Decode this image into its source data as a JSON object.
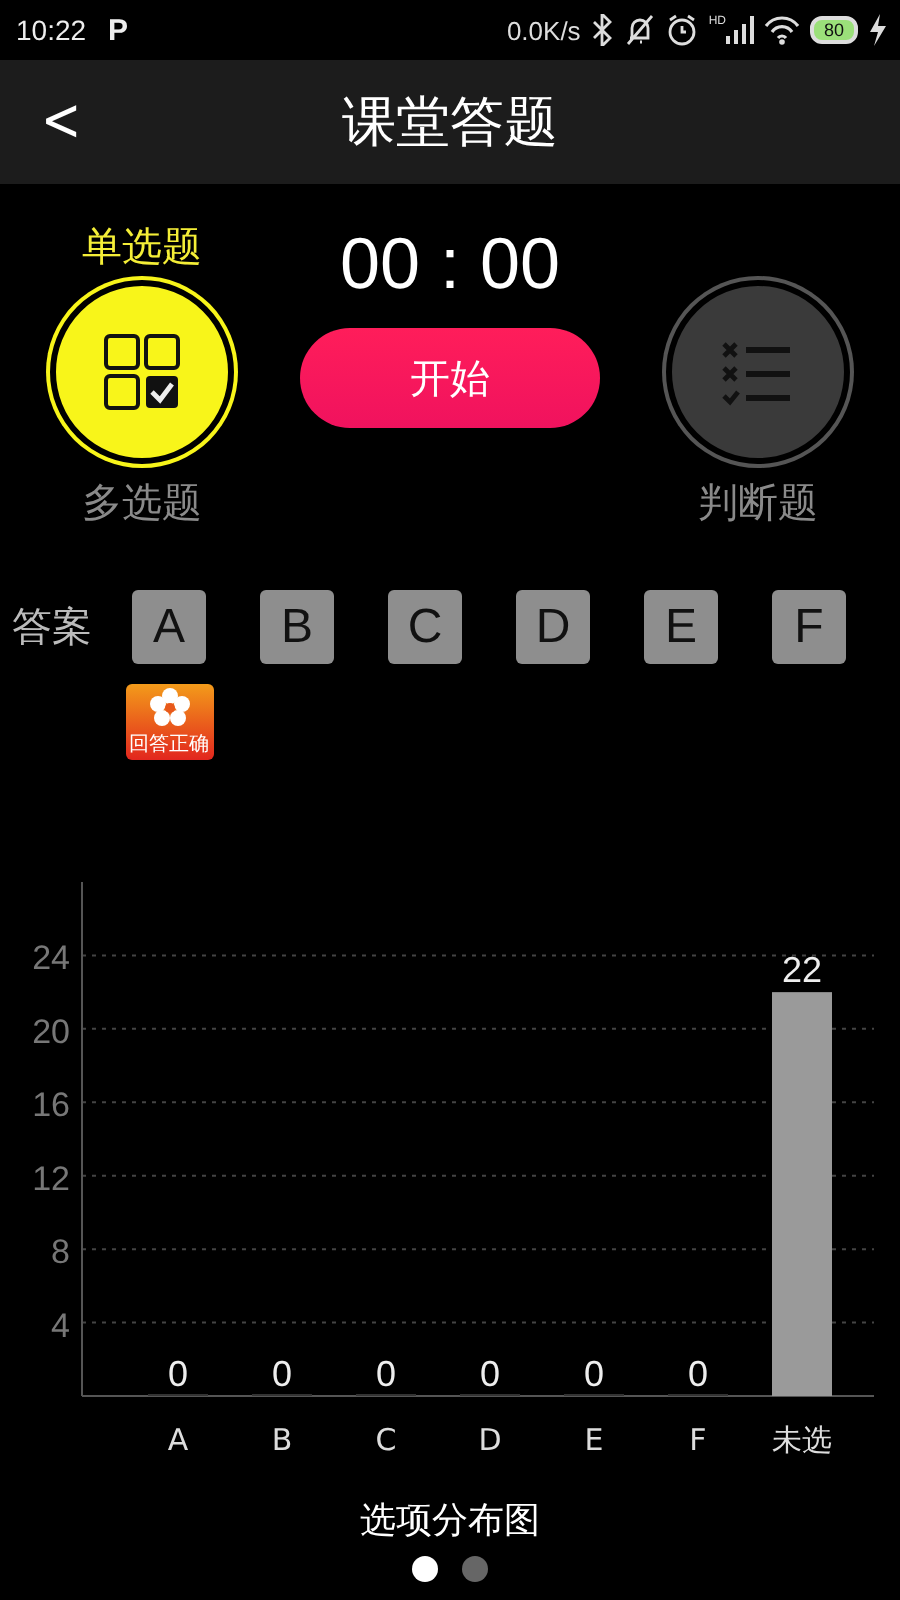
{
  "status_bar": {
    "time": "10:22",
    "app_badge": "P",
    "net_speed": "0.0K/s",
    "signal_tag": "HD",
    "battery": "80"
  },
  "header": {
    "back": "<",
    "title": "课堂答题"
  },
  "question_types": [
    {
      "label": "单选题",
      "selected": true
    },
    {
      "label": "多选题",
      "selected": false
    },
    {
      "label": "判断题",
      "selected": false
    }
  ],
  "timer": "00 : 00",
  "start_button": "开始",
  "answers": {
    "label": "答案",
    "options": [
      {
        "label": "A",
        "correct": true
      },
      {
        "label": "B",
        "correct": false
      },
      {
        "label": "C",
        "correct": false
      },
      {
        "label": "D",
        "correct": false
      },
      {
        "label": "E",
        "correct": false
      },
      {
        "label": "F",
        "correct": false
      }
    ],
    "correct_badge": "回答正确"
  },
  "chart_data": {
    "type": "bar",
    "title": "选项分布图",
    "categories": [
      "A",
      "B",
      "C",
      "D",
      "E",
      "F",
      "未选"
    ],
    "values": [
      0,
      0,
      0,
      0,
      0,
      0,
      22
    ],
    "ylim": [
      0,
      28
    ],
    "grid": true,
    "yticks": [
      4,
      8,
      12,
      16,
      20,
      24
    ],
    "data_labels": true
  },
  "pager": [
    {
      "selected": true
    },
    {
      "selected": false
    }
  ]
}
